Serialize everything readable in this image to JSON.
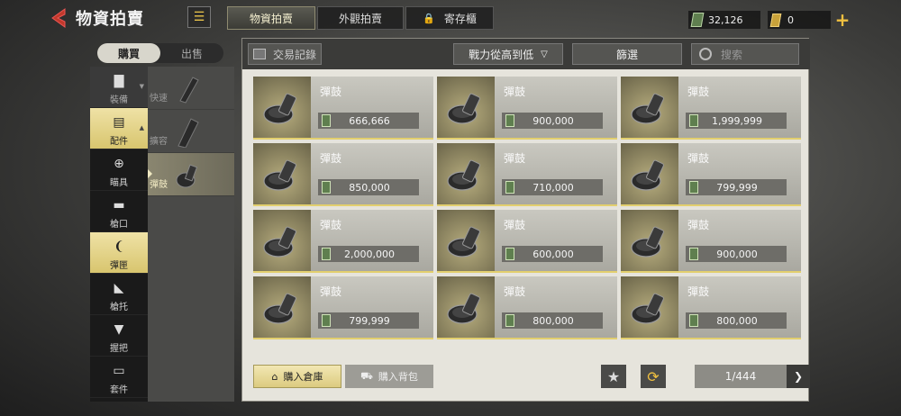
{
  "header": {
    "title": "物資拍賣",
    "tabs": [
      {
        "label": "物資拍賣",
        "active": true
      },
      {
        "label": "外觀拍賣",
        "active": false
      },
      {
        "label": "寄存櫃",
        "active": false,
        "locked": true
      }
    ],
    "currency": {
      "cash": "32,126",
      "gold": "0"
    }
  },
  "side": {
    "mode_tabs": [
      "購買",
      "出售"
    ],
    "categories": [
      {
        "label": "裝備",
        "icon": "vest-icon"
      },
      {
        "label": "配件",
        "icon": "battery-icon"
      },
      {
        "label": "瞄具",
        "icon": "scope-icon"
      },
      {
        "label": "槍口",
        "icon": "muzzle-icon"
      },
      {
        "label": "彈匣",
        "icon": "magazine-icon"
      },
      {
        "label": "槍托",
        "icon": "stock-icon"
      },
      {
        "label": "握把",
        "icon": "grip-icon"
      },
      {
        "label": "套件",
        "icon": "kit-icon"
      }
    ],
    "subcategories": [
      {
        "label": "快速"
      },
      {
        "label": "擴容"
      },
      {
        "label": "彈鼓"
      }
    ]
  },
  "toolbar": {
    "history": "交易記錄",
    "sort": "戰力從高到低",
    "filter": "篩選",
    "search_placeholder": "搜索"
  },
  "listings": [
    {
      "name": "彈鼓",
      "price": "666,666"
    },
    {
      "name": "彈鼓",
      "price": "900,000"
    },
    {
      "name": "彈鼓",
      "price": "1,999,999"
    },
    {
      "name": "彈鼓",
      "price": "850,000"
    },
    {
      "name": "彈鼓",
      "price": "710,000"
    },
    {
      "name": "彈鼓",
      "price": "799,999"
    },
    {
      "name": "彈鼓",
      "price": "2,000,000"
    },
    {
      "name": "彈鼓",
      "price": "600,000"
    },
    {
      "name": "彈鼓",
      "price": "900,000"
    },
    {
      "name": "彈鼓",
      "price": "799,999"
    },
    {
      "name": "彈鼓",
      "price": "800,000"
    },
    {
      "name": "彈鼓",
      "price": "800,000"
    }
  ],
  "footer": {
    "to_warehouse": "購入倉庫",
    "to_backpack": "購入背包",
    "page": "1/444"
  },
  "colors": {
    "accent": "#e2cf6e",
    "panel": "#e6e4dc",
    "price_box": "#6e6d68"
  }
}
